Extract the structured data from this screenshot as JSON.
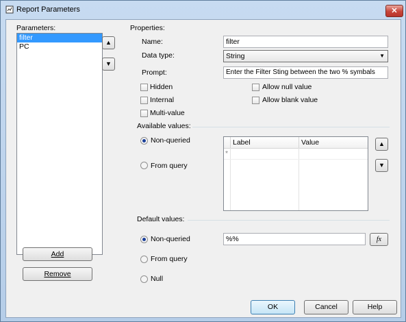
{
  "window": {
    "title": "Report Parameters",
    "close": "✕"
  },
  "params": {
    "label": "Parameters:",
    "items": [
      "filter",
      "PC"
    ],
    "selected_index": 0,
    "add": "Add",
    "remove": "Remove"
  },
  "properties": {
    "header": "Properties:",
    "name_label": "Name:",
    "name_value": "filter",
    "type_label": "Data type:",
    "type_value": "String",
    "prompt_label": "Prompt:",
    "prompt_value": "Enter the Filter Sting between the two % symbals",
    "checks": {
      "hidden": "Hidden",
      "internal": "Internal",
      "multi": "Multi-value",
      "allow_null": "Allow null value",
      "allow_blank": "Allow blank value"
    }
  },
  "available": {
    "header": "Available values:",
    "non_queried": "Non-queried",
    "from_query": "From query",
    "col_label": "Label",
    "col_value": "Value",
    "new_row_marker": "*"
  },
  "default": {
    "header": "Default values:",
    "non_queried": "Non-queried",
    "from_query": "From query",
    "null": "Null",
    "value": "%%",
    "fx": "fx"
  },
  "footer": {
    "ok": "OK",
    "cancel": "Cancel",
    "help": "Help"
  }
}
